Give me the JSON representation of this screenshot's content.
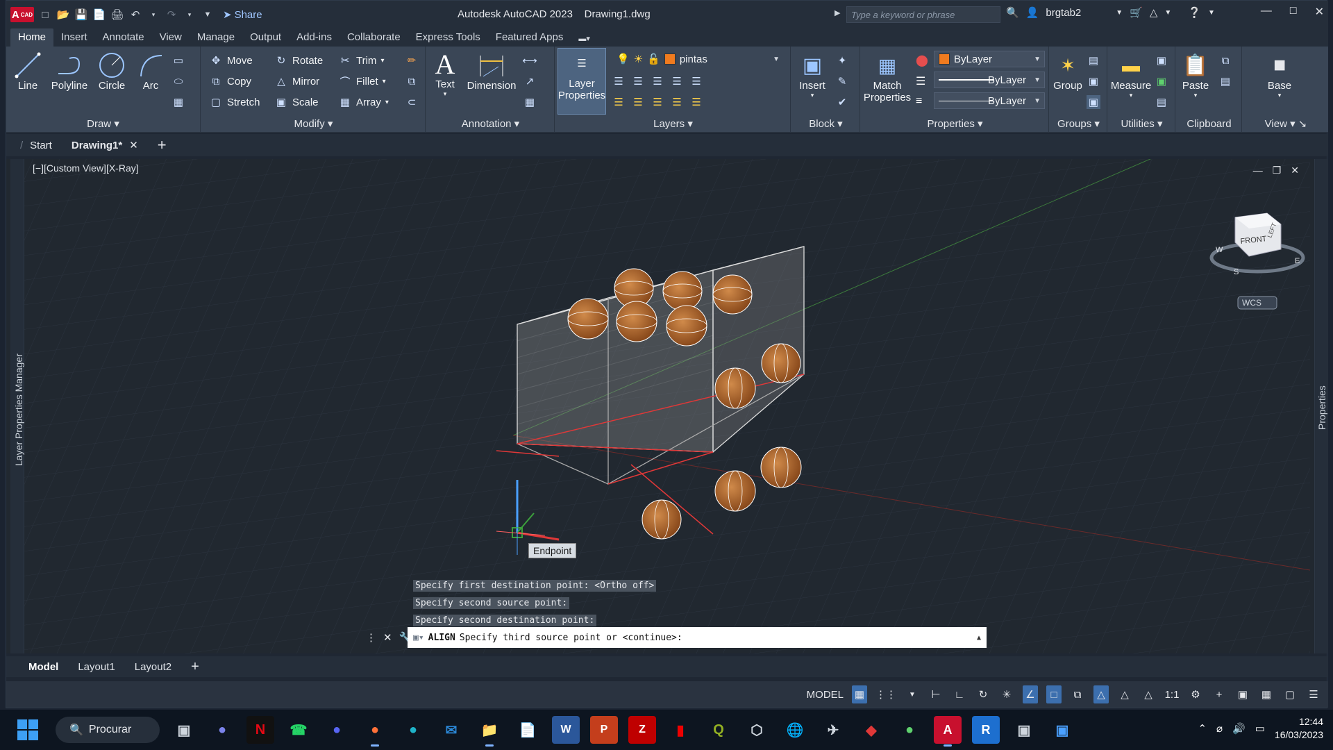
{
  "app": {
    "title": "Autodesk AutoCAD 2023    Drawing1.dwg",
    "logo_text": "A",
    "logo_sub": "CAD",
    "share_label": "Share",
    "search_placeholder": "Type a keyword or phrase",
    "user": "brgtab2"
  },
  "ribbon_tabs": [
    "Home",
    "Insert",
    "Annotate",
    "View",
    "Manage",
    "Output",
    "Add-ins",
    "Collaborate",
    "Express Tools",
    "Featured Apps"
  ],
  "ribbon": {
    "draw": {
      "title": "Draw",
      "line": "Line",
      "polyline": "Polyline",
      "circle": "Circle",
      "arc": "Arc"
    },
    "modify": {
      "title": "Modify",
      "move": "Move",
      "rotate": "Rotate",
      "trim": "Trim",
      "copy": "Copy",
      "mirror": "Mirror",
      "fillet": "Fillet",
      "stretch": "Stretch",
      "scale": "Scale",
      "array": "Array"
    },
    "annotation": {
      "title": "Annotation",
      "text": "Text",
      "dimension": "Dimension"
    },
    "layers": {
      "title": "Layers",
      "layer_properties_1": "Layer",
      "layer_properties_2": "Properties",
      "current_layer": "pintas"
    },
    "block": {
      "title": "Block",
      "insert": "Insert"
    },
    "properties": {
      "title": "Properties",
      "match_1": "Match",
      "match_2": "Properties",
      "color": "ByLayer",
      "lineweight": "ByLayer",
      "linetype": "ByLayer"
    },
    "groups": {
      "title": "Groups",
      "group": "Group"
    },
    "utilities": {
      "title": "Utilities",
      "measure": "Measure"
    },
    "clipboard": {
      "title": "Clipboard",
      "paste": "Paste"
    },
    "view": {
      "title": "View",
      "base": "Base"
    }
  },
  "doc_tabs": {
    "start": "Start",
    "drawing": "Drawing1*"
  },
  "viewport": {
    "label": "[−][Custom View][X-Ray]",
    "side_left": "Layer Properties Manager",
    "side_right": "Properties",
    "viewcube_front": "FRONT",
    "viewcube_left": "LEFT",
    "viewcube_s": "S",
    "viewcube_e": "E",
    "viewcube_w": "W",
    "wcs": "WCS",
    "tooltip": "Endpoint"
  },
  "command": {
    "history": [
      "Specify first destination point:  <Ortho off>",
      "Specify second source point:",
      "Specify second destination point:"
    ],
    "command_name": "ALIGN",
    "prompt": "Specify third source point or <continue>:"
  },
  "layout_tabs": [
    "Model",
    "Layout1",
    "Layout2"
  ],
  "status": {
    "model": "MODEL",
    "scale": "1:1"
  },
  "taskbar": {
    "search": "Procurar",
    "time": "12:44",
    "date": "16/03/2023"
  },
  "colors": {
    "accent": "#3c6fae",
    "layer_color": "#f07b1f",
    "autocad_red": "#c8102e"
  }
}
